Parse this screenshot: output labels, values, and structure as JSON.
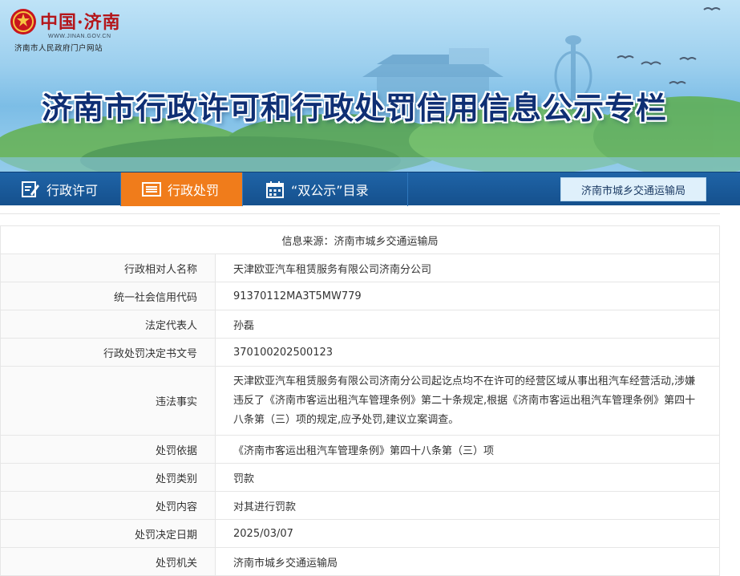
{
  "header": {
    "site_name": "中国·济南",
    "site_url": "WWW.JINAN.GOV.CN",
    "site_subtitle": "济南市人民政府门户网站",
    "banner_title": "济南市行政许可和行政处罚信用信息公示专栏"
  },
  "nav": {
    "items": [
      {
        "label": "行政许可",
        "icon": "document-edit-icon",
        "active": false
      },
      {
        "label": "行政处罚",
        "icon": "list-icon",
        "active": true
      },
      {
        "label": "“双公示”目录",
        "icon": "calendar-icon",
        "active": false
      }
    ],
    "department_button": "济南市城乡交通运输局"
  },
  "record": {
    "source": "信息来源：济南市城乡交通运输局",
    "fields": [
      {
        "label": "行政相对人名称",
        "value": "天津欧亚汽车租赁服务有限公司济南分公司"
      },
      {
        "label": "统一社会信用代码",
        "value": "91370112MA3T5MW779"
      },
      {
        "label": "法定代表人",
        "value": "孙磊"
      },
      {
        "label": "行政处罚决定书文号",
        "value": "370100202500123"
      },
      {
        "label": "违法事实",
        "value": "天津欧亚汽车租赁服务有限公司济南分公司起讫点均不在许可的经营区域从事出租汽车经营活动,涉嫌违反了《济南市客运出租汽车管理条例》第二十条规定,根据《济南市客运出租汽车管理条例》第四十八条第（三）项的规定,应予处罚,建议立案调查。"
      },
      {
        "label": "处罚依据",
        "value": "《济南市客运出租汽车管理条例》第四十八条第（三）项"
      },
      {
        "label": "处罚类别",
        "value": "罚款"
      },
      {
        "label": "处罚内容",
        "value": "对其进行罚款"
      },
      {
        "label": "处罚决定日期",
        "value": "2025/03/07"
      },
      {
        "label": "处罚机关",
        "value": "济南市城乡交通运输局"
      }
    ]
  },
  "colors": {
    "nav_bg": "#1a5b9c",
    "nav_active": "#f07c1b",
    "title_color": "#0f2f74",
    "emblem_red": "#c8161d"
  }
}
